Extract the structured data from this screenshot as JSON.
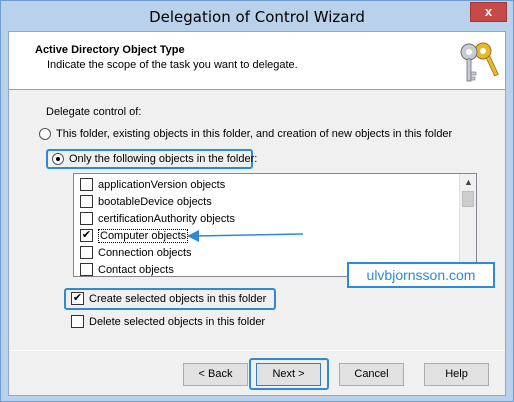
{
  "window": {
    "title": "Delegation of Control Wizard",
    "close_glyph": "x"
  },
  "header": {
    "title": "Active Directory Object Type",
    "subtitle": "Indicate the scope of the task you want to delegate.",
    "icon": "keys-icon"
  },
  "delegate_label": "Delegate control of:",
  "radios": [
    {
      "label": "This folder, existing objects in this folder, and creation of new objects in this folder",
      "selected": false
    },
    {
      "label": "Only the following objects in the folder:",
      "selected": true
    }
  ],
  "object_list": [
    {
      "label": "applicationVersion objects",
      "checked": false
    },
    {
      "label": "bootableDevice objects",
      "checked": false
    },
    {
      "label": "certificationAuthority objects",
      "checked": false
    },
    {
      "label": "Computer objects",
      "checked": true
    },
    {
      "label": "Connection objects",
      "checked": false
    },
    {
      "label": "Contact objects",
      "checked": false
    }
  ],
  "create_checkbox": {
    "label": "Create selected objects in this folder",
    "checked": true
  },
  "delete_checkbox": {
    "label": "Delete selected objects in this folder",
    "checked": false
  },
  "watermark": "ulvbjornsson.com",
  "buttons": {
    "back": "< Back",
    "next": "Next >",
    "cancel": "Cancel",
    "help": "Help"
  },
  "colors": {
    "highlight": "#2e8ad8",
    "title_bar": "#b9d1ea",
    "close": "#c74a49"
  }
}
